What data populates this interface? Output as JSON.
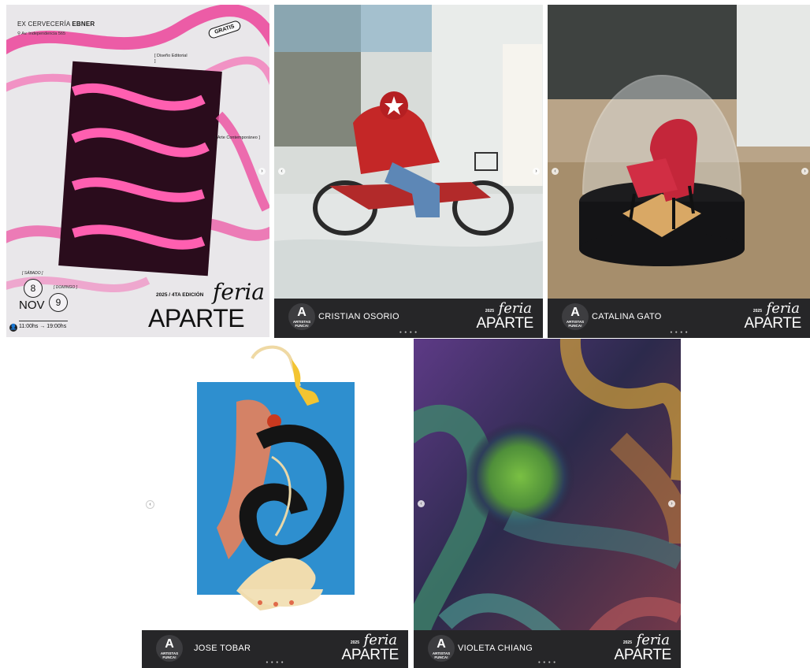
{
  "poster": {
    "venue_prefix": "EX CERVECERÍA",
    "venue_bold": "EBNER",
    "address": "Av. Independencia 565",
    "free_badge": "GRATIS",
    "tag_design": "[ Diseño Editorial ]",
    "tag_art": "[ Arte Contemporáneo ]",
    "saturday_word": "[ SÁBADO ]",
    "sunday_word": "[ DOMINGO ]",
    "day_one": "8",
    "day_two": "9",
    "month": "NOV",
    "hours": "11:00hs → 19:00hs",
    "edition": "2025 / 4TA EDICIÓN",
    "feria": "feria",
    "aparte": "APARTE"
  },
  "banner": {
    "logo_mark": "A",
    "logo_org": "ARTISTAS FUNCA!",
    "year": "2025",
    "feria": "feria",
    "aparte": "APARTE"
  },
  "posts": [
    {
      "artist": "CRISTIAN OSORIO"
    },
    {
      "artist": "CATALINA GATO"
    },
    {
      "artist": "JOSE TOBAR"
    },
    {
      "artist": "VIOLETA CHIANG"
    }
  ],
  "icons": {
    "prev": "‹",
    "next": "›",
    "dots": "● ● ● ●",
    "pin": "⚲",
    "user": "👤"
  },
  "colors": {
    "banner_bg": "#262628",
    "poster_pink": "#e8489a",
    "poster_bg": "#e9e7ea"
  }
}
